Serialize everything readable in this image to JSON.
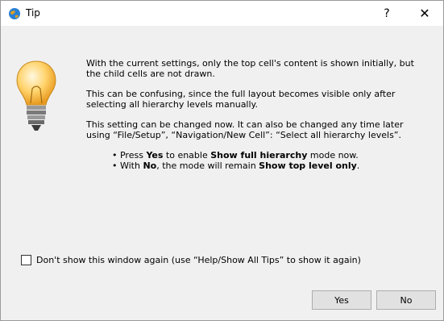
{
  "window": {
    "title": "Tip",
    "help_label": "?",
    "close_label": "✕"
  },
  "message": {
    "p1": "With the current settings, only the top cell's content is shown initially, but the child cells are not drawn.",
    "p2": "This can be confusing, since the full layout becomes visible only after selecting all hierarchy levels manually.",
    "p3": "This setting can be changed now. It can also be changed any time later using “File/Setup”, “Navigation/New Cell”: “Select all hierarchy levels”.",
    "b1_pre": "• Press ",
    "b1_yes": "Yes",
    "b1_mid": " to enable ",
    "b1_bold": "Show full hierarchy",
    "b1_post": " mode now.",
    "b2_pre": "• With ",
    "b2_no": "No",
    "b2_mid": ", the mode will remain ",
    "b2_bold": "Show top level only",
    "b2_post": "."
  },
  "checkbox": {
    "label": "Don't show this window again (use “Help/Show All Tips” to show it again)",
    "checked": false
  },
  "buttons": {
    "yes": "Yes",
    "no": "No"
  },
  "icons": {
    "app": "globe-icon",
    "illustration": "lightbulb-icon"
  }
}
